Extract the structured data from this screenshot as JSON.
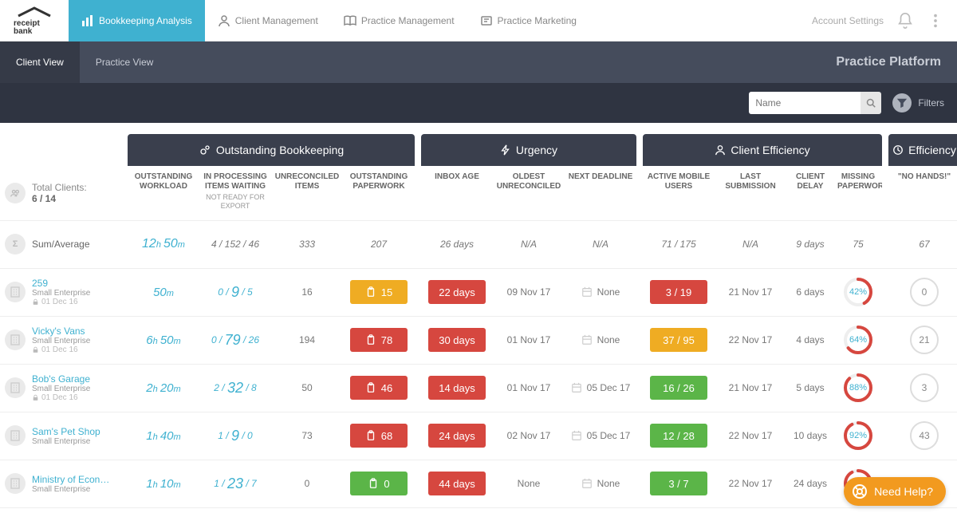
{
  "nav": {
    "items": [
      "Bookkeeping Analysis",
      "Client Management",
      "Practice Management",
      "Practice Marketing"
    ],
    "account": "Account Settings"
  },
  "subnav": {
    "tabs": [
      "Client View",
      "Practice View"
    ],
    "title": "Practice Platform"
  },
  "filter": {
    "placeholder": "Name",
    "filters_label": "Filters"
  },
  "groups": {
    "g1": "Outstanding Bookkeeping",
    "g2": "Urgency",
    "g3": "Client Efficiency",
    "g4": "Efficiency"
  },
  "columns": {
    "c1": "OUTSTANDING WORKLOAD",
    "c2": "IN PROCESSING ITEMS WAITING",
    "c2s": "NOT READY FOR EXPORT",
    "c3": "UNRECONCILED ITEMS",
    "c4": "OUTSTANDING PAPERWORK",
    "c5": "INBOX AGE",
    "c6": "OLDEST UNRECONCILED",
    "c7": "NEXT DEADLINE",
    "c8": "ACTIVE MOBILE USERS",
    "c9": "LAST SUBMISSION",
    "c10": "CLIENT DELAY",
    "c11": "MISSING PAPERWORK",
    "c12": "\"NO HANDS!\""
  },
  "left": {
    "total_label": "Total Clients:",
    "total_value": "6 / 14",
    "sum_label": "Sum/Average"
  },
  "sum": {
    "workload": "12h 50m",
    "proc": "4 / 152 / 46",
    "unrec": "333",
    "paperwork": "207",
    "inbox": "26 days",
    "oldest": "N/A",
    "deadline": "N/A",
    "mobile": "71 / 175",
    "submission": "N/A",
    "delay": "9 days",
    "missing": "75",
    "eff": "67"
  },
  "rows": [
    {
      "name": "259",
      "sub": "Small Enterprise",
      "date": "01 Dec 16",
      "workload_h": "",
      "workload_m": "50m",
      "proc_a": "0",
      "proc_b": "9",
      "proc_c": "5",
      "unrec": "16",
      "paper_n": "15",
      "paper_color": "yellow",
      "inbox": "22 days",
      "inbox_color": "red",
      "oldest": "09 Nov 17",
      "deadline": "None",
      "mobile": "3 / 19",
      "mobile_color": "red",
      "submission": "21 Nov 17",
      "delay": "6 days",
      "missing_pct": 42,
      "eff": "0"
    },
    {
      "name": "Vicky's Vans",
      "sub": "Small Enterprise",
      "date": "01 Dec 16",
      "workload_h": "6h ",
      "workload_m": "50m",
      "proc_a": "0",
      "proc_b": "79",
      "proc_c": "26",
      "unrec": "194",
      "paper_n": "78",
      "paper_color": "red",
      "inbox": "30 days",
      "inbox_color": "red",
      "oldest": "01 Nov 17",
      "deadline": "None",
      "mobile": "37 / 95",
      "mobile_color": "yellow",
      "submission": "22 Nov 17",
      "delay": "4 days",
      "missing_pct": 64,
      "eff": "21"
    },
    {
      "name": "Bob's Garage",
      "sub": "Small Enterprise",
      "date": "01 Dec 16",
      "workload_h": "2h ",
      "workload_m": "20m",
      "proc_a": "2",
      "proc_b": "32",
      "proc_c": "8",
      "unrec": "50",
      "paper_n": "46",
      "paper_color": "red",
      "inbox": "14 days",
      "inbox_color": "red",
      "oldest": "01 Nov 17",
      "deadline": "05 Dec 17",
      "mobile": "16 / 26",
      "mobile_color": "green",
      "submission": "21 Nov 17",
      "delay": "5 days",
      "missing_pct": 88,
      "eff": "3"
    },
    {
      "name": "Sam's Pet Shop",
      "sub": "Small Enterprise",
      "date": "",
      "workload_h": "1h ",
      "workload_m": "40m",
      "proc_a": "1",
      "proc_b": "9",
      "proc_c": "0",
      "unrec": "73",
      "paper_n": "68",
      "paper_color": "red",
      "inbox": "24 days",
      "inbox_color": "red",
      "oldest": "02 Nov 17",
      "deadline": "05 Dec 17",
      "mobile": "12 / 28",
      "mobile_color": "green",
      "submission": "22 Nov 17",
      "delay": "10 days",
      "missing_pct": 92,
      "eff": "43"
    },
    {
      "name": "Ministry of Econ…",
      "sub": "Small Enterprise",
      "date": "",
      "workload_h": "1h ",
      "workload_m": "10m",
      "proc_a": "1",
      "proc_b": "23",
      "proc_c": "7",
      "unrec": "0",
      "paper_n": "0",
      "paper_color": "green",
      "inbox": "44 days",
      "inbox_color": "red",
      "oldest": "None",
      "deadline": "None",
      "mobile": "3 / 7",
      "mobile_color": "green",
      "submission": "22 Nov 17",
      "delay": "24 days",
      "missing_pct": 92,
      "eff": ""
    }
  ],
  "help": "Need Help?"
}
